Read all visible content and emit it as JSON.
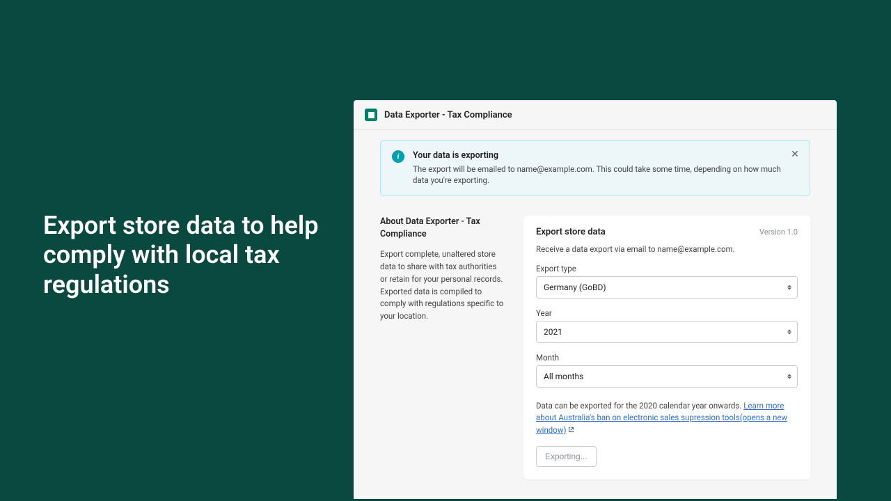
{
  "hero": {
    "headline": "Export store data to help comply with local tax regulations"
  },
  "app": {
    "title": "Data Exporter - Tax Compliance"
  },
  "banner": {
    "title": "Your data is exporting",
    "text": "The export will be emailed to name@example.com. This could take some time, depending on how much data you're exporting."
  },
  "about": {
    "title": "About Data Exporter - Tax Compliance",
    "text": "Export complete, unaltered store data to share with tax authorities or retain for your personal records. Exported data is compiled to comply with regulations specific to your location."
  },
  "card": {
    "title": "Export store data",
    "version": "Version 1.0",
    "subtext": "Receive a data export via email to name@example.com.",
    "fields": {
      "export_type": {
        "label": "Export type",
        "value": "Germany (GoBD)"
      },
      "year": {
        "label": "Year",
        "value": "2021"
      },
      "month": {
        "label": "Month",
        "value": "All months"
      }
    },
    "note_prefix": "Data can be exported for the 2020 calendar year onwards. ",
    "note_link": "Learn more about Australia's ban on electronic sales supression tools(opens a new window)",
    "button": "Exporting..."
  }
}
